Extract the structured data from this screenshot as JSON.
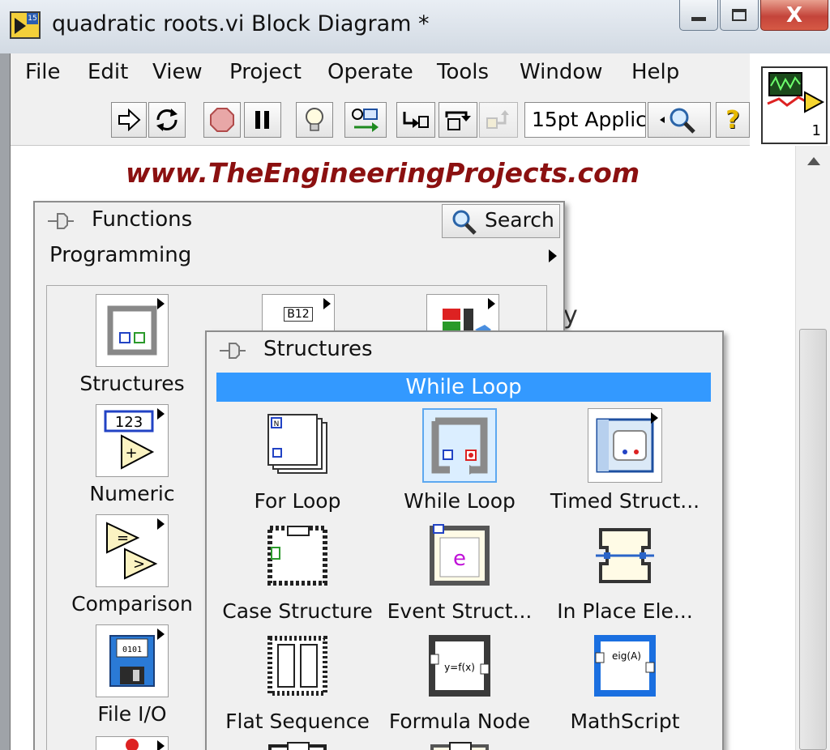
{
  "window": {
    "title": "quadratic roots.vi Block Diagram *",
    "app_badge": "15",
    "close_label": "X"
  },
  "menu": [
    "File",
    "Edit",
    "View",
    "Project",
    "Operate",
    "Tools",
    "Window",
    "Help"
  ],
  "toolbar": {
    "buttons": [
      "run-arrow-icon",
      "run-continuously-icon",
      "abort-icon",
      "pause-icon",
      "highlight-execution-icon",
      "retain-wire-values-icon",
      "step-into-icon",
      "step-over-icon",
      "step-out-icon"
    ],
    "font_setting": "15pt Applic",
    "help_label": "?",
    "vi_icon_number": "1"
  },
  "diagram": {
    "watermark": "www.TheEngineeringProjects.com",
    "partial_text": "y"
  },
  "functions_palette": {
    "title": "Functions",
    "search_label": "Search",
    "category": "Programming",
    "items": [
      {
        "label": "Structures",
        "icon": "structures-icon"
      },
      {
        "label": "",
        "icon": "array-icon",
        "glyph": "B12"
      },
      {
        "label": "",
        "icon": "cluster-icon"
      },
      {
        "label": "Numeric",
        "icon": "numeric-icon",
        "glyph": "123"
      },
      {
        "label": "Comparison",
        "icon": "comparison-icon"
      },
      {
        "label": "File I/O",
        "icon": "file-io-icon"
      }
    ]
  },
  "structures_palette": {
    "title": "Structures",
    "tooltip": "While Loop",
    "items": [
      {
        "label": "For Loop",
        "icon": "for-loop-icon",
        "glyph": "N"
      },
      {
        "label": "While Loop",
        "icon": "while-loop-icon",
        "selected": true
      },
      {
        "label": "Timed Struct...",
        "icon": "timed-structure-icon"
      },
      {
        "label": "Case Structure",
        "icon": "case-structure-icon"
      },
      {
        "label": "Event Struct...",
        "icon": "event-structure-icon",
        "glyph": "e"
      },
      {
        "label": "In Place Ele...",
        "icon": "in-place-element-icon"
      },
      {
        "label": "Flat Sequence",
        "icon": "flat-sequence-icon"
      },
      {
        "label": "Formula Node",
        "icon": "formula-node-icon",
        "glyph": "y=f(x)"
      },
      {
        "label": "MathScript",
        "icon": "mathscript-icon",
        "glyph": "eig(A)"
      }
    ]
  }
}
